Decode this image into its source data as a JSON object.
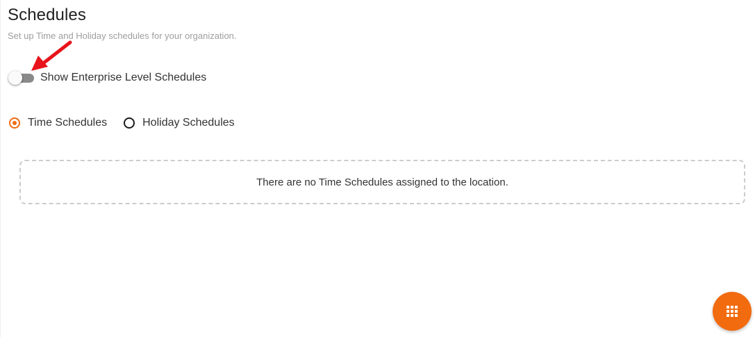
{
  "header": {
    "title": "Schedules",
    "subtitle": "Set up Time and Holiday schedules for your organization."
  },
  "enterprise_toggle": {
    "label": "Show Enterprise Level Schedules",
    "checked": false
  },
  "schedule_type": {
    "options": [
      {
        "label": "Time Schedules",
        "selected": true
      },
      {
        "label": "Holiday Schedules",
        "selected": false
      }
    ]
  },
  "empty_state": {
    "message": "There are no Time Schedules assigned to the location."
  },
  "fab": {
    "icon": "apps-grid-icon"
  },
  "colors": {
    "accent": "#f26b0f",
    "annotation_arrow": "#e8141b",
    "toggle_track": "#8a8a8a",
    "border_dashed": "#cccccc"
  }
}
